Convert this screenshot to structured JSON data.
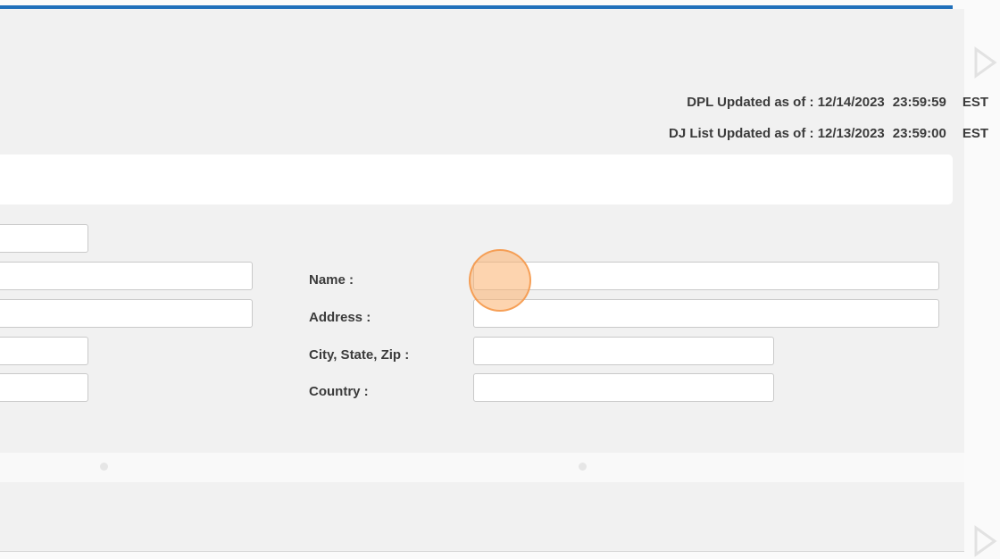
{
  "status": {
    "dpl_label": "DPL Updated as of :",
    "dpl_date": "12/14/2023",
    "dpl_time": "23:59:59",
    "dpl_tz": "EST",
    "dj_label": "DJ List Updated as of :",
    "dj_date": "12/13/2023",
    "dj_time": "23:59:00",
    "dj_tz": "EST"
  },
  "form": {
    "name_label": "Name :",
    "address_label": "Address :",
    "city_label": "City, State, Zip :",
    "country_label": "Country :",
    "name_value": "",
    "address_value": "",
    "city_value": "",
    "country_value": ""
  },
  "colors": {
    "accent": "#1f6fba",
    "panel": "#f1f1f1",
    "cursor": "#f5964a"
  }
}
